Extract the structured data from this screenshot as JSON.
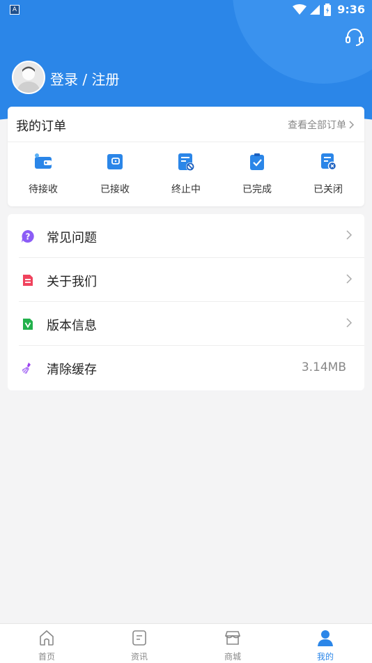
{
  "status_bar": {
    "time": "9:36",
    "app_badge": "A"
  },
  "profile": {
    "login_text": "登录 / 注册"
  },
  "orders": {
    "title": "我的订单",
    "view_all": "查看全部订单",
    "items": [
      {
        "label": "待接收",
        "icon": "wallet-icon"
      },
      {
        "label": "已接收",
        "icon": "wallet-received-icon"
      },
      {
        "label": "终止中",
        "icon": "document-ban-icon"
      },
      {
        "label": "已完成",
        "icon": "clipboard-check-icon"
      },
      {
        "label": "已关闭",
        "icon": "document-close-icon"
      }
    ]
  },
  "menu": [
    {
      "label": "常见问题",
      "icon": "question-icon",
      "color": "#8b5cf6"
    },
    {
      "label": "关于我们",
      "icon": "document-icon",
      "color": "#f0435d"
    },
    {
      "label": "版本信息",
      "icon": "version-icon",
      "color": "#22b14c"
    },
    {
      "label": "清除缓存",
      "icon": "broom-icon",
      "color": "#9b3ff0",
      "value": "3.14MB"
    }
  ],
  "bottom_nav": [
    {
      "label": "首页",
      "icon": "home-icon",
      "active": false
    },
    {
      "label": "资讯",
      "icon": "news-icon",
      "active": false
    },
    {
      "label": "商城",
      "icon": "store-icon",
      "active": false
    },
    {
      "label": "我的",
      "icon": "user-icon",
      "active": true
    }
  ],
  "colors": {
    "primary": "#2b86e8",
    "background": "#f4f4f5"
  }
}
